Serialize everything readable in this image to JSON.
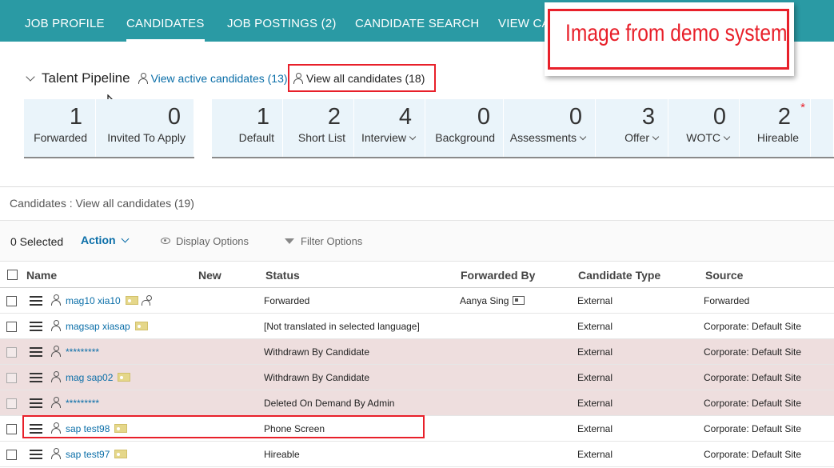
{
  "nav": {
    "tabs": [
      {
        "label": "JOB PROFILE",
        "active": false
      },
      {
        "label": "CANDIDATES",
        "active": true
      },
      {
        "label": "JOB POSTINGS (2)",
        "active": false
      },
      {
        "label": "CANDIDATE SEARCH",
        "active": false
      },
      {
        "label": "VIEW CA",
        "active": false
      }
    ]
  },
  "overlay": {
    "text": "Image from demo system",
    "color": "#e8202a"
  },
  "pipeline": {
    "title": "Talent Pipeline",
    "active_link": "View active candidates (13)",
    "all_link": "View all candidates (18)",
    "group1": [
      {
        "num": "1",
        "label": "Forwarded",
        "dropdown": false
      },
      {
        "num": "0",
        "label": "Invited To Apply",
        "dropdown": false
      }
    ],
    "group2": [
      {
        "num": "1",
        "label": "Default",
        "dropdown": false
      },
      {
        "num": "2",
        "label": "Short List",
        "dropdown": false
      },
      {
        "num": "4",
        "label": "Interview",
        "dropdown": true
      },
      {
        "num": "0",
        "label": "Background",
        "dropdown": false
      },
      {
        "num": "0",
        "label": "Assessments",
        "dropdown": true
      },
      {
        "num": "3",
        "label": "Offer",
        "dropdown": true
      },
      {
        "num": "0",
        "label": "WOTC",
        "dropdown": true
      },
      {
        "num": "2",
        "label": "Hireable",
        "dropdown": false,
        "star": "*"
      }
    ]
  },
  "crumb": "Candidates : View all candidates (19)",
  "toolbar": {
    "selected": "0 Selected",
    "action": "Action",
    "display_options": "Display Options",
    "filter_options": "Filter Options"
  },
  "table": {
    "headers": {
      "name": "Name",
      "new": "New",
      "status": "Status",
      "forwarded_by": "Forwarded By",
      "candidate_type": "Candidate Type",
      "source": "Source"
    },
    "rows": [
      {
        "name": "mag10 xia10",
        "status": "Forwarded",
        "forwarded_by": "Aanya Sing",
        "type": "External",
        "source": "Forwarded",
        "pink": false
      },
      {
        "name": "magsap xiasap",
        "status": "[Not translated in selected language]",
        "forwarded_by": "",
        "type": "External",
        "source": "Corporate: Default Site",
        "pink": false
      },
      {
        "name": "*********",
        "status": "Withdrawn By Candidate",
        "forwarded_by": "",
        "type": "External",
        "source": "Corporate: Default Site",
        "pink": true
      },
      {
        "name": "mag sap02",
        "status": "Withdrawn By Candidate",
        "forwarded_by": "",
        "type": "External",
        "source": "Corporate: Default Site",
        "pink": true
      },
      {
        "name": "*********",
        "status": "Deleted On Demand By Admin",
        "forwarded_by": "",
        "type": "External",
        "source": "Corporate: Default Site",
        "pink": true
      },
      {
        "name": "sap test98",
        "status": "Phone Screen",
        "forwarded_by": "",
        "type": "External",
        "source": "Corporate: Default Site",
        "pink": false
      },
      {
        "name": "sap test97",
        "status": "Hireable",
        "forwarded_by": "",
        "type": "External",
        "source": "Corporate: Default Site",
        "pink": false
      }
    ]
  }
}
